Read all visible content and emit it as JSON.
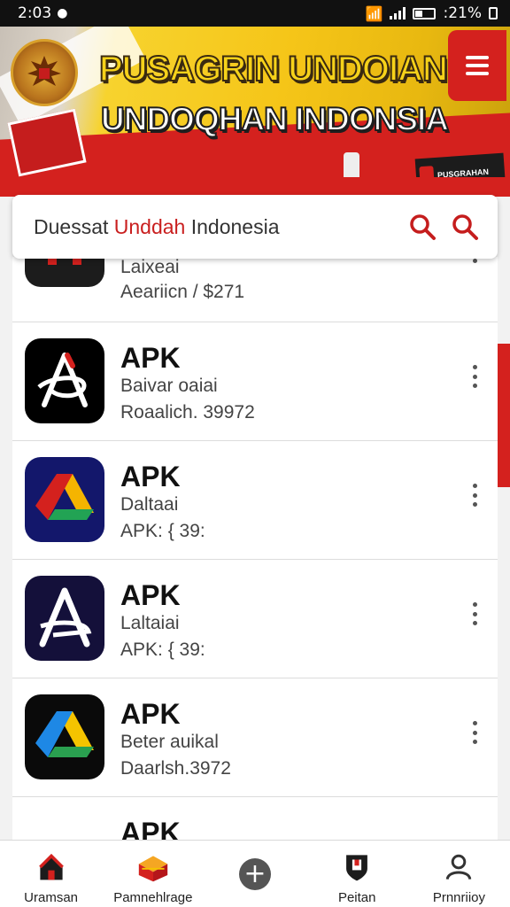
{
  "status_bar": {
    "time": "2:03",
    "battery": ":21%"
  },
  "banner": {
    "title_line1": "PUSAGRIN UNDOIAN",
    "title_line2": "UNDOQHAN INDONSIA",
    "mini_logo_text": "PUSGRAHAN"
  },
  "search": {
    "query_prefix": "Duessat ",
    "query_highlight": "Unddah",
    "query_suffix": " Indonesia"
  },
  "apps": [
    {
      "title": "",
      "line1": "Laixeai",
      "line2": "Aeariicn / $271",
      "icon": "red-black-app-icon",
      "colors": [
        "#1c1c1c",
        "#d4211e"
      ]
    },
    {
      "title": "APK",
      "line1": "Baivar oaiai",
      "line2": "Roaalich. 39972",
      "icon": "black-swirl-a-icon",
      "colors": [
        "#000000",
        "#d4211e"
      ]
    },
    {
      "title": "APK",
      "line1": "Daltaai",
      "line2": "APK: { 39:",
      "icon": "drive-triangle-navy-icon",
      "colors": [
        "#13176b",
        "#f5b400",
        "#d4211e",
        "#22a354"
      ]
    },
    {
      "title": "APK",
      "line1": "Laltaiai",
      "line2": "APK: { 39:",
      "icon": "white-a-navy-icon",
      "colors": [
        "#14103a",
        "#ffffff"
      ]
    },
    {
      "title": "APK",
      "line1": "Beter auikal",
      "line2": "Daarlsh.3972",
      "icon": "drive-triangle-black-icon",
      "colors": [
        "#0a0a0a",
        "#f5c400",
        "#1e88e5",
        "#2aa050"
      ]
    },
    {
      "title": "APK",
      "line1": "",
      "line2": "",
      "icon": "colorful-app-icon",
      "colors": [
        "#ffffff",
        "#4a90d9",
        "#f5c400"
      ]
    }
  ],
  "bottom_nav": [
    {
      "label": "Uramsan",
      "icon": "home-icon"
    },
    {
      "label": "Pamnehlrage",
      "icon": "box-icon"
    },
    {
      "label": "",
      "icon": "plus-icon"
    },
    {
      "label": "Peitan",
      "icon": "shield-icon"
    },
    {
      "label": "Prnnriioy",
      "icon": "profile-icon"
    }
  ],
  "colors": {
    "accent_red": "#d4211e",
    "banner_yellow": "#f5c518"
  }
}
